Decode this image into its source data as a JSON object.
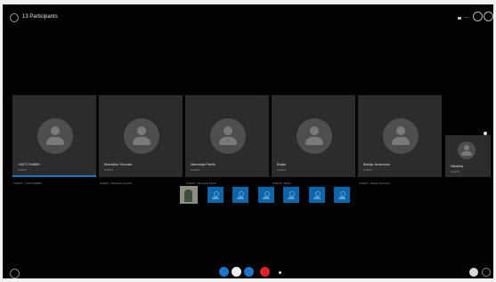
{
  "header": {
    "participants_label": "13 Participants",
    "more_label": "..."
  },
  "tiles": [
    {
      "name": "+4672744889",
      "role": "GUEST",
      "caption": "GUEST - +4672744889",
      "active": true
    },
    {
      "name": "Branislav Soncan",
      "role": "GUEST",
      "caption": "GUEST - Branislav Soncan",
      "active": false
    },
    {
      "name": "Nemanja Pavlic",
      "role": "GUEST",
      "caption": "GUEST - Nemanja Pavlic",
      "active": false
    },
    {
      "name": "Bojan",
      "role": "GUEST",
      "caption": "GUEST - Bojan",
      "active": false
    },
    {
      "name": "Marija Jovanovic",
      "role": "GUEST",
      "caption": "GUEST - Marija Jovanovic",
      "active": false
    }
  ],
  "extra_tile": {
    "name": "Nikolina",
    "role": "GUEST"
  },
  "thumbnails_count": 7,
  "controls": [
    "video",
    "mute",
    "share-screen",
    "hang-up",
    "more"
  ],
  "colors": {
    "accent": "#1b76c9",
    "hangup": "#e0202c",
    "tile_bg": "#2c2c2c",
    "background": "#030303"
  }
}
